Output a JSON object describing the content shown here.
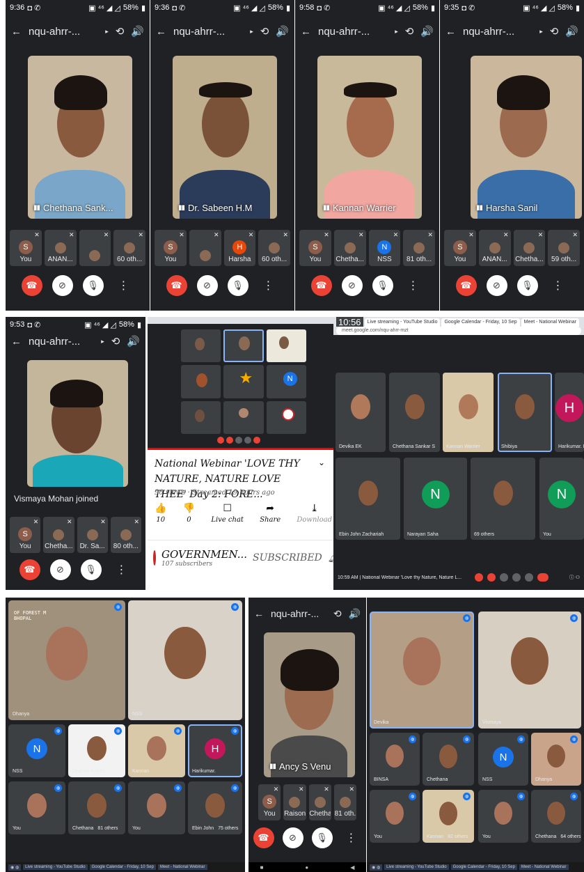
{
  "phones": [
    {
      "time": "9:36",
      "battery": "58%",
      "title": "nqu-ahrr-...",
      "speaker": "Chethana Sank...",
      "strip": [
        {
          "label": "You",
          "avatar": "S"
        },
        {
          "label": "ANAN..."
        },
        {
          "label": ""
        },
        {
          "label": "60 oth..."
        }
      ]
    },
    {
      "time": "9:36",
      "battery": "58%",
      "title": "nqu-ahrr-...",
      "speaker": "Dr. Sabeen H.M",
      "strip": [
        {
          "label": "You",
          "avatar": "S"
        },
        {
          "label": ""
        },
        {
          "label": "Harsha",
          "avatar": "H"
        },
        {
          "label": "60 oth..."
        }
      ]
    },
    {
      "time": "9:58",
      "battery": "58%",
      "title": "nqu-ahrr-...",
      "speaker": "Kannan Warrier",
      "strip": [
        {
          "label": "You",
          "avatar": "S"
        },
        {
          "label": "Chetha..."
        },
        {
          "label": "NSS",
          "avatar": "N"
        },
        {
          "label": "81 oth..."
        }
      ]
    },
    {
      "time": "9:35",
      "battery": "58%",
      "title": "nqu-ahrr-...",
      "speaker": "Harsha Sanil",
      "strip": [
        {
          "label": "You",
          "avatar": "S"
        },
        {
          "label": "ANAN..."
        },
        {
          "label": "Chetha..."
        },
        {
          "label": "59 oth..."
        }
      ]
    }
  ],
  "phone5": {
    "time": "9:53",
    "battery": "58%",
    "title": "nqu-ahrr-...",
    "joined": "Vismaya Mohan joined",
    "strip": [
      {
        "label": "You",
        "avatar": "S"
      },
      {
        "label": "Chetha..."
      },
      {
        "label": "Dr. Sa..."
      },
      {
        "label": "80 oth..."
      }
    ]
  },
  "youtube": {
    "title": "National Webinar 'LOVE THY NATURE, NATURE LOVE THEE' Day 2: FORE...",
    "meta": "90 views · Streamed 19 hours ago",
    "actions": [
      {
        "icon": "like-icon",
        "glyph": "👍",
        "label": "10"
      },
      {
        "icon": "dislike-icon",
        "glyph": "👎",
        "label": "0"
      },
      {
        "icon": "live-chat-icon",
        "glyph": "☐",
        "label": "Live chat"
      },
      {
        "icon": "share-icon",
        "glyph": "➦",
        "label": "Share"
      },
      {
        "icon": "download-icon",
        "glyph": "⤓",
        "label": "Download"
      }
    ],
    "channel": "GOVERNMEN...",
    "subscribers": "107 subscribers",
    "subscribe": "SUBSCRIBED"
  },
  "desktop": {
    "clock": "10:56",
    "tabs": [
      "Live streaming - YouTube Studio",
      "Google Calendar - Friday, 10 Sep",
      "Meet - National Webinar"
    ],
    "url": "meet.google.com/nqu-ahrr-mzt",
    "tiles": [
      {
        "label": "Devika EK"
      },
      {
        "label": "Chethana Sankar S"
      },
      {
        "label": "Kannan Warrier"
      },
      {
        "label": "Shibiya"
      },
      {
        "label": "Harikumar. K",
        "avatar": "H"
      },
      {
        "label": "Ebin John Zachariah"
      },
      {
        "label": "Narayan Saha",
        "avatar": "N"
      },
      {
        "label": "69 others"
      },
      {
        "label": "You",
        "avatar": "N"
      }
    ],
    "bottom": "10:59 AM | National Webinar 'Love thy Nature, Nature L..."
  },
  "bottomLeft": {
    "tiles": [
      {
        "label": "Dhanya"
      },
      {
        "label": "NSS"
      },
      {
        "label": "NSS",
        "avatar": "N"
      },
      {
        "label": "Dhanya is pres..."
      },
      {
        "label": "Kannan"
      },
      {
        "label": "Harikumar.",
        "avatar": "H"
      },
      {
        "label": "You"
      },
      {
        "label": "Chethana",
        "extra": "81 others"
      },
      {
        "label": "You"
      },
      {
        "label": "Ebin John",
        "extra": "75 others"
      }
    ],
    "logo": "OF FOREST M BHOPAL"
  },
  "phone6": {
    "title": "nqu-ahrr-...",
    "speaker": "Ancy S Venu",
    "strip": [
      {
        "label": "You",
        "avatar": "S"
      },
      {
        "label": "Raison"
      },
      {
        "label": "Chetha..."
      },
      {
        "label": "81 oth..."
      }
    ]
  },
  "bottomRight": {
    "tiles": [
      {
        "label": "Devika"
      },
      {
        "label": "Vismaya"
      },
      {
        "label": "BINSA"
      },
      {
        "label": "Chethana"
      },
      {
        "label": "NSS",
        "avatar": "N"
      },
      {
        "label": "Dhanya"
      },
      {
        "label": "You"
      },
      {
        "label": "Kannan",
        "extra": "82 others"
      },
      {
        "label": "You"
      },
      {
        "label": "Chethana",
        "extra": "64 others"
      }
    ]
  },
  "colors": {
    "meetBg": "#202124",
    "tile": "#3c4043",
    "end": "#ea4335",
    "nssBlue": "#1a73e8",
    "teal": "#0f9d58",
    "pink": "#c2185b",
    "orange": "#e8710a",
    "brown": "#8d5d4c"
  }
}
